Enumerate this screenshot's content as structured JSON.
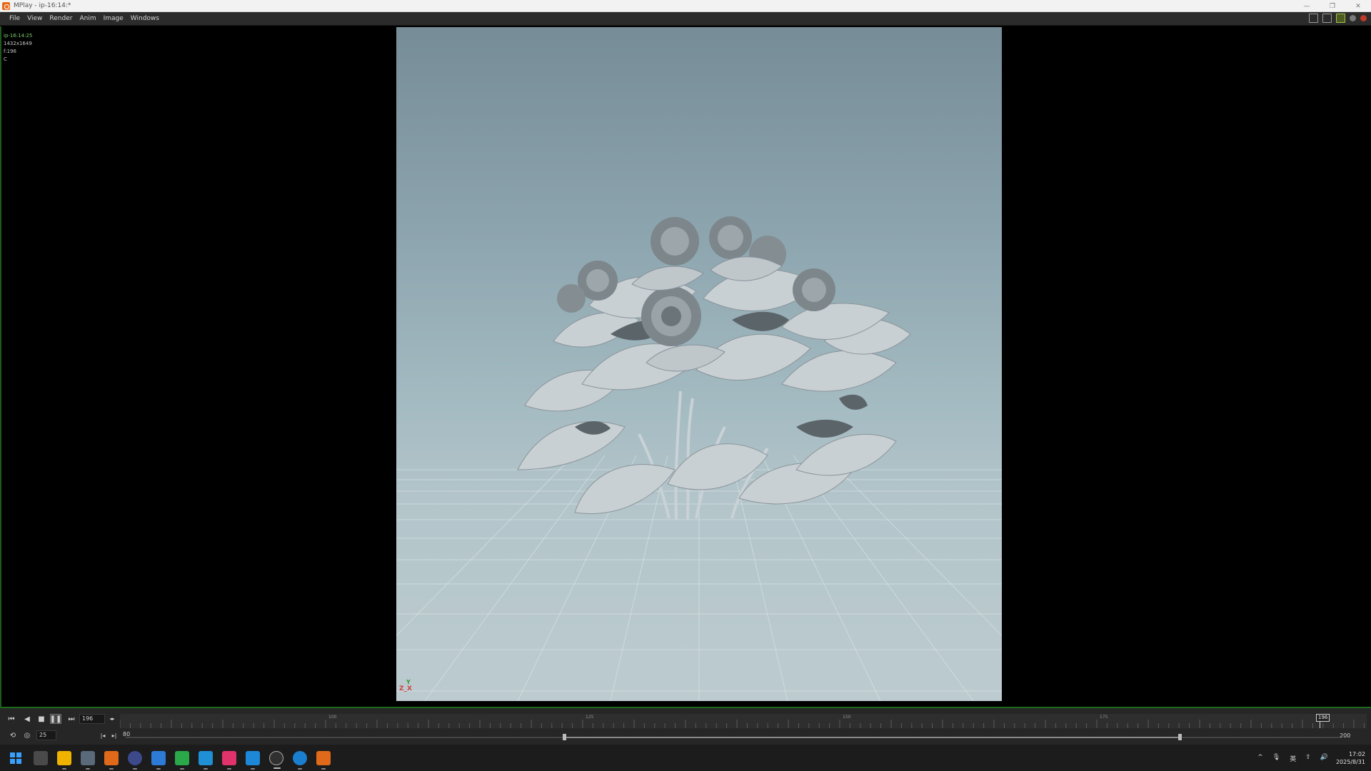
{
  "window": {
    "title": "MPlay - ip-16:14:*",
    "controls": [
      "—",
      "❐",
      "✕"
    ]
  },
  "menubar": {
    "items": [
      "File",
      "View",
      "Render",
      "Anim",
      "Image",
      "Windows"
    ]
  },
  "viewport": {
    "info_lines": [
      "ip-16:14:25",
      "1432x1649",
      "f:196",
      "C"
    ],
    "axis_x": "Z_X",
    "axis_y": "Y"
  },
  "timeline": {
    "current_frame": "196",
    "step_value": "25",
    "range_start": "80",
    "range_end": "200",
    "frame_marker": "196",
    "ruler_labels": [
      "100",
      "125",
      "150",
      "175"
    ]
  },
  "taskbar": {
    "apps": [
      {
        "name": "windows-start",
        "color": "#1e90ff"
      },
      {
        "name": "task-view",
        "color": "#3a3a3a"
      },
      {
        "name": "file-explorer",
        "color": "#f0b400"
      },
      {
        "name": "notepad",
        "color": "#4a5a6a"
      },
      {
        "name": "houdini",
        "color": "#e06a1a"
      },
      {
        "name": "browser-circle",
        "color": "#3c4a8c"
      },
      {
        "name": "app-blue",
        "color": "#2d7bd6"
      },
      {
        "name": "app-green",
        "color": "#2aa84a"
      },
      {
        "name": "app-cyan",
        "color": "#1f8fd6"
      },
      {
        "name": "app-pink",
        "color": "#e0336b"
      },
      {
        "name": "app-vscode",
        "color": "#1e88d8"
      },
      {
        "name": "app-obs",
        "color": "#303030"
      },
      {
        "name": "edge",
        "color": "#1a7fcf"
      },
      {
        "name": "houdini-2",
        "color": "#e06a1a"
      }
    ],
    "tray_icons": [
      "^",
      "🎙",
      "英",
      "⇧",
      "🔊"
    ],
    "time": "17:02",
    "date": "2025/8/31"
  }
}
